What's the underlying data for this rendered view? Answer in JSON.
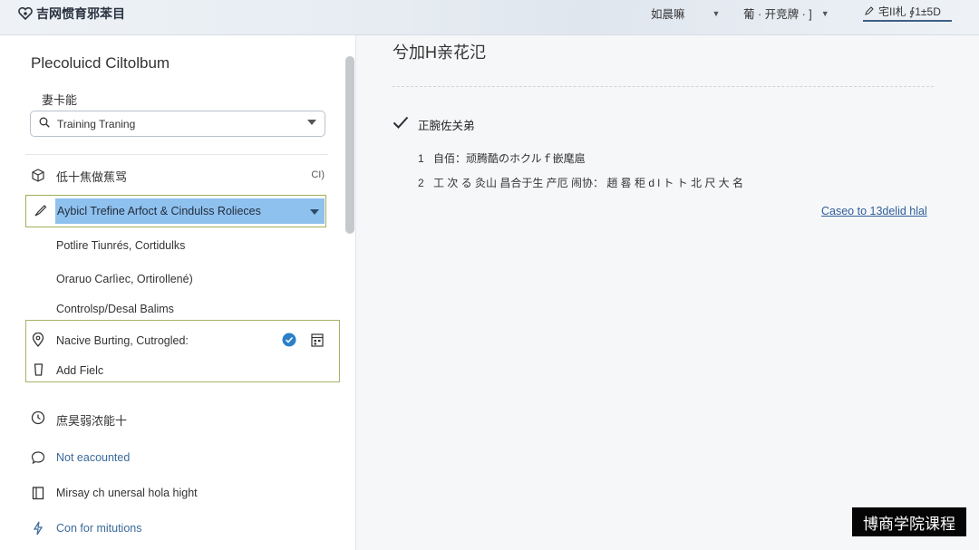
{
  "header": {
    "brand_title": "吉网惯育邪苯目",
    "menu1_label": "如晨嘛",
    "menu2_label": "葡 · 开竞牌 · ]",
    "right_button_label": "宅II札 ∮1±5D"
  },
  "sidebar": {
    "title": "Plecoluicd Ciltolbum",
    "section_label": "妻卡能",
    "search_value": "Training Traning",
    "section_row": {
      "label": "低十焦做蕉骂",
      "count": "CI)"
    },
    "selected_item": "Aybicl Trefine Arfoct & Cindulss Rolieces",
    "sub_items": [
      "Potlire Tiunrés, Cortidulks",
      "Oraruo Carlìec, Ortirollené)",
      "Controlsp/Desal Balims"
    ],
    "group": {
      "row1": "Nacive Burting, Cutrogled:",
      "row2": "Add Fielc"
    },
    "list_items": [
      {
        "label": "庶昊弱浓能十",
        "icon": "clock-icon"
      },
      {
        "label": "Not eacounted",
        "icon": "speech-bubble-icon"
      },
      {
        "label": "Mirsay ch unersal hola hight",
        "icon": "book-icon"
      },
      {
        "label": "Con for mitutions",
        "icon": "bolt-icon"
      }
    ]
  },
  "main": {
    "title": "兮加H亲花氾",
    "task_heading": "正腕佐关弟",
    "steps": [
      {
        "num": "1",
        "text": "自佰：顽腾酷のホクルｆ嵌麾扈"
      },
      {
        "num": "2",
        "text": "工 次 る 灸山 昌合于生 产厄 闹协： 趙 晷 秬 d l ト ト 北 尺 大 名"
      }
    ],
    "link_label": "Caseo to 13delid hlal"
  },
  "watermark": "博商学院课程",
  "colors": {
    "selection_highlight": "#8fc1ef",
    "outline_green": "#a0ad5a",
    "link_blue": "#2f5f9a",
    "check_blue": "#2d7fc8"
  }
}
